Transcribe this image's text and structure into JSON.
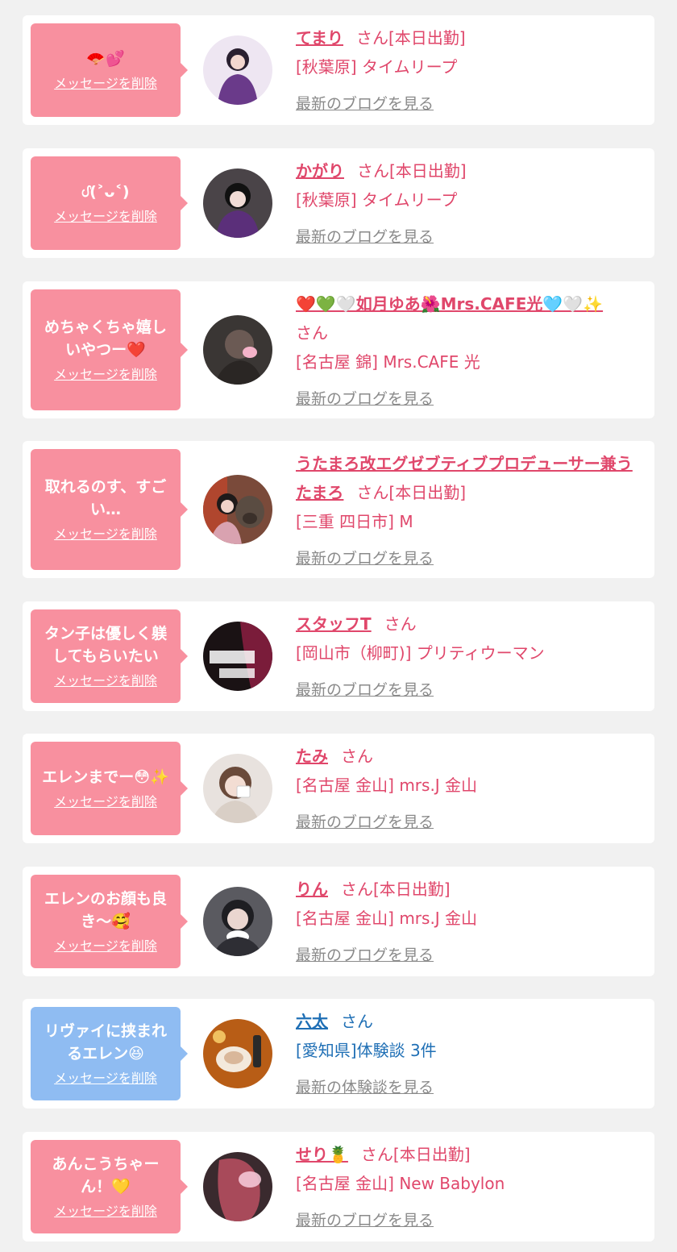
{
  "delete_label": "メッセージを削除",
  "cards": [
    {
      "message": "🪭💕",
      "name": "てまり",
      "suffix": "さん[本日出勤]",
      "shop": "[秋葉原] タイムリープ",
      "link": "最新のブログを見る"
    },
    {
      "message": "ᦔ(˃ᴗ˂)",
      "name": "かがり",
      "suffix": "さん[本日出勤]",
      "shop": "[秋葉原] タイムリープ",
      "link": "最新のブログを見る"
    },
    {
      "message": "めちゃくちゃ嬉しいやつー❤️",
      "name": "❤️💚🤍如月ゆあ🌺Mrs.CAFE光🩵🤍✨",
      "suffix": "さん",
      "shop": "[名古屋 錦] Mrs.CAFE 光",
      "link": "最新のブログを見る"
    },
    {
      "message": "取れるのす、すごい…",
      "name": "うたまろ改エグゼブティブプロデューサー兼うたまろ",
      "suffix": "さん[本日出勤]",
      "shop": "[三重 四日市] M",
      "link": "最新のブログを見る"
    },
    {
      "message": "タン子は優しく躾してもらいたい",
      "name": "スタッフT",
      "suffix": "さん",
      "shop": "[岡山市（柳町)] プリティウーマン",
      "link": "最新のブログを見る"
    },
    {
      "message": "エレンまでー😳✨",
      "name": "たみ",
      "suffix": "さん",
      "shop": "[名古屋 金山] mrs.J 金山",
      "link": "最新のブログを見る"
    },
    {
      "message": "エレンのお顔も良き〜🥰",
      "name": "りん",
      "suffix": "さん[本日出勤]",
      "shop": "[名古屋 金山] mrs.J 金山",
      "link": "最新のブログを見る"
    },
    {
      "message": "リヴァイに挟まれるエレン😆",
      "name": "六太",
      "suffix": "さん",
      "shop": "[愛知県]体験談 3件",
      "link": "最新の体験談を見る"
    },
    {
      "message": "あんこうちゃーん！💛",
      "name": "せり🍍",
      "suffix": "さん[本日出勤]",
      "shop": "[名古屋 金山] New Babylon",
      "link": "最新のブログを見る"
    }
  ]
}
